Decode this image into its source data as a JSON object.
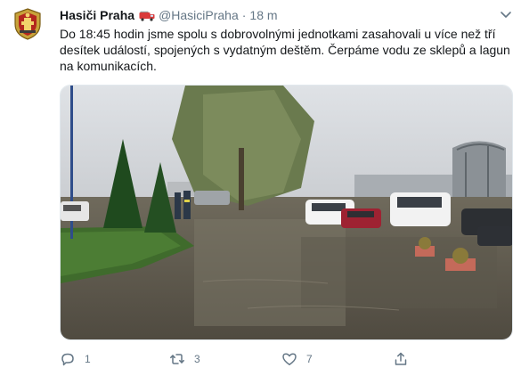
{
  "tweet": {
    "display_name": "Hasiči Praha",
    "handle": "@HasiciPraha",
    "separator": "·",
    "time": "18 m",
    "text": "Do 18:45 hodin jsme spolu s dobrovolnými jednotkami zasahovali u více než tří desítek událostí, spojených s vydatným deštěm. Čerpáme vodu ze sklepů a lagun na komunikacích.",
    "avatar_icon": "fire-brigade-emblem-icon",
    "badge_icon": "fire-truck-emoji-icon",
    "media_description_icon": "flooded-parking-lot-photo"
  },
  "actions": {
    "reply_count": "1",
    "retweet_count": "3",
    "like_count": "7",
    "share_label": ""
  },
  "colors": {
    "text": "#14171a",
    "secondary": "#657786",
    "border": "#e1e8ed"
  }
}
